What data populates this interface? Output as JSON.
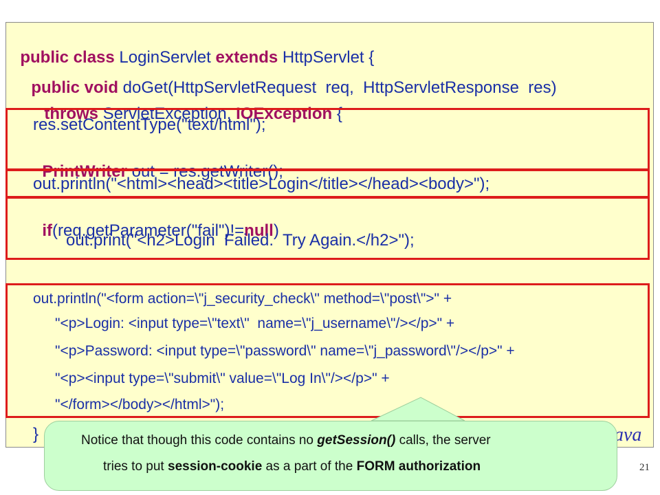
{
  "code": {
    "l1": {
      "kw1": "public class",
      "t1": " LoginServlet ",
      "kw2": "extends",
      "t2": " HttpServlet {"
    },
    "l2": {
      "kw1": "public void",
      "t1": " doGet(HttpServletRequest  req,  HttpServletResponse  res)"
    },
    "l3": {
      "kw1": "throws",
      "t1": " ServletException, ",
      "kw2": "IOException",
      "t2": " {"
    },
    "l4": "res.setContentType(\"text/html\");",
    "l5": {
      "kw1": "PrintWriter",
      "t1": " out = res.getWriter();"
    },
    "l6": "out.println(\"<html><head><title>Login</title></head><body>\");",
    "l7": {
      "kw1": "if",
      "t1": "(req.getParameter(\"fail\")!=",
      "kw2": "null",
      "t2": ")"
    },
    "l8": "out.print(\"<h2>Login  Failed.  Try Again.</h2>\");",
    "l9": "out.println(\"<form action=\\\"j_security_check\\\" method=\\\"post\\\">\" +",
    "l10": "\"<p>Login: <input type=\\\"text\\\"  name=\\\"j_username\\\"/></p>\" +",
    "l11": "\"<p>Password: <input type=\\\"password\\\" name=\\\"j_password\\\"/></p>\" +",
    "l12": "\"<p><input type=\\\"submit\\\" value=\\\"Log In\\\"/></p>\" +",
    "l13": "\"</form></body></html>\");",
    "l14": "}"
  },
  "watermark": "ava",
  "slide_number": "21",
  "callout": {
    "line1_pre": "Notice that though this code contains no ",
    "line1_em": "getSession()",
    "line1_post": " calls, the server",
    "line2_pre": "tries to put ",
    "line2_b1": "session-cookie",
    "line2_mid": " as a part of the ",
    "line2_b2": "FORM authorization"
  },
  "colors": {
    "panel": "#ffffcc",
    "highlight": "#dd1c1c",
    "keyword": "#a01060",
    "text": "#1a2fa6",
    "callout": "#ccffcc"
  }
}
